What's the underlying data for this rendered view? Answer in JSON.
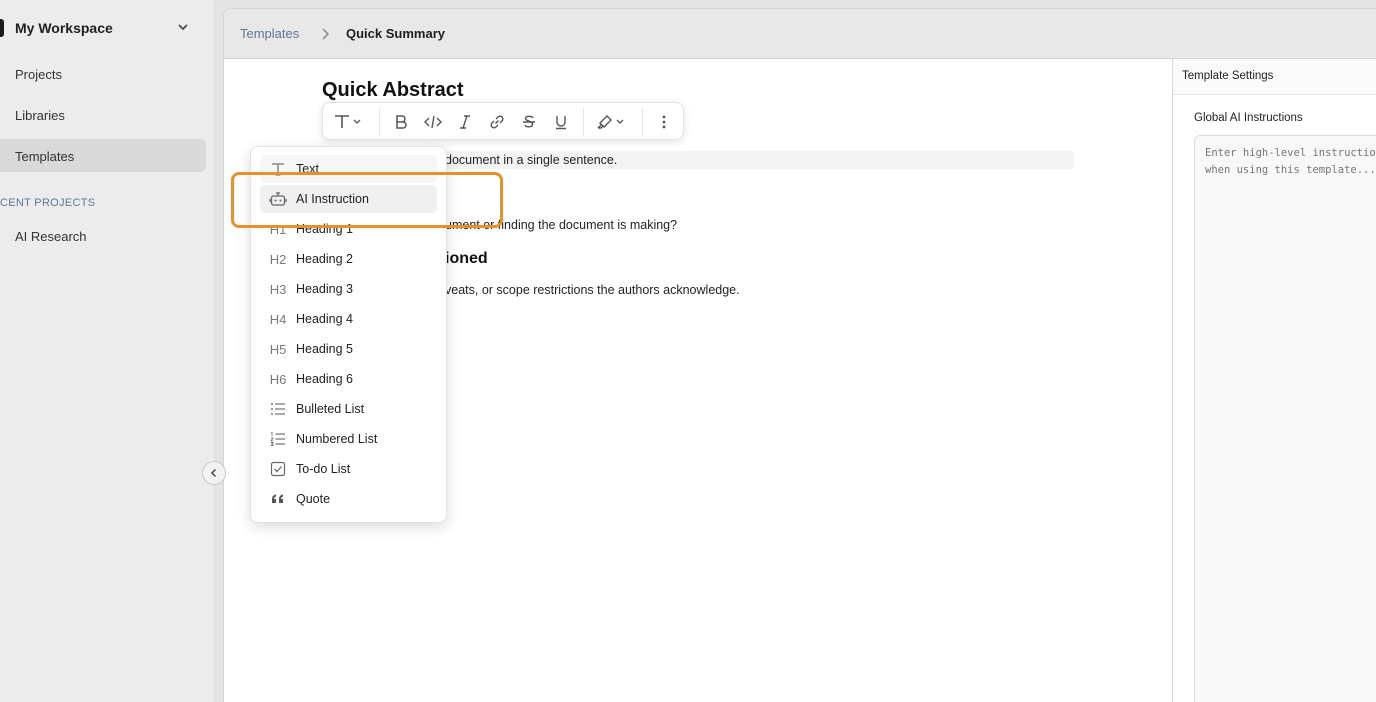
{
  "sidebar": {
    "workspace_title": "My Workspace",
    "nav": [
      "Projects",
      "Libraries",
      "Templates"
    ],
    "active_nav": "Templates",
    "recent_label": "CENT PROJECTS",
    "recent_items": [
      "AI Research"
    ]
  },
  "breadcrumb": {
    "root": "Templates",
    "current": "Quick Summary"
  },
  "document": {
    "title": "Quick Abstract",
    "line1_tail": "document in a single sentence.",
    "line2_tail": "ument or finding the document is making?",
    "heading2_tail": "ioned",
    "line3_tail": "veats, or scope restrictions the authors acknowledge."
  },
  "toolbar": {
    "icons": [
      "text-type-icon",
      "bold-icon",
      "code-icon",
      "italic-icon",
      "link-icon",
      "strikethrough-icon",
      "underline-icon",
      "highlighter-icon",
      "more-icon"
    ]
  },
  "block_menu": {
    "items": [
      {
        "label": "Text",
        "icon": "T"
      },
      {
        "label": "AI Instruction",
        "icon": "robot"
      },
      {
        "label": "Heading 1",
        "icon": "H1"
      },
      {
        "label": "Heading 2",
        "icon": "H2"
      },
      {
        "label": "Heading 3",
        "icon": "H3"
      },
      {
        "label": "Heading 4",
        "icon": "H4"
      },
      {
        "label": "Heading 5",
        "icon": "H5"
      },
      {
        "label": "Heading 6",
        "icon": "H6"
      },
      {
        "label": "Bulleted List",
        "icon": "bullets"
      },
      {
        "label": "Numbered List",
        "icon": "numbers"
      },
      {
        "label": "To-do List",
        "icon": "checkbox"
      },
      {
        "label": "Quote",
        "icon": "quote"
      }
    ]
  },
  "settings": {
    "title": "Template Settings",
    "global_ai_label": "Global AI Instructions",
    "global_ai_placeholder": "Enter high-level instructions\nwhen using this template..."
  },
  "colors": {
    "accent_orange": "#e8902f",
    "breadcrumb_link": "#5f7795"
  }
}
